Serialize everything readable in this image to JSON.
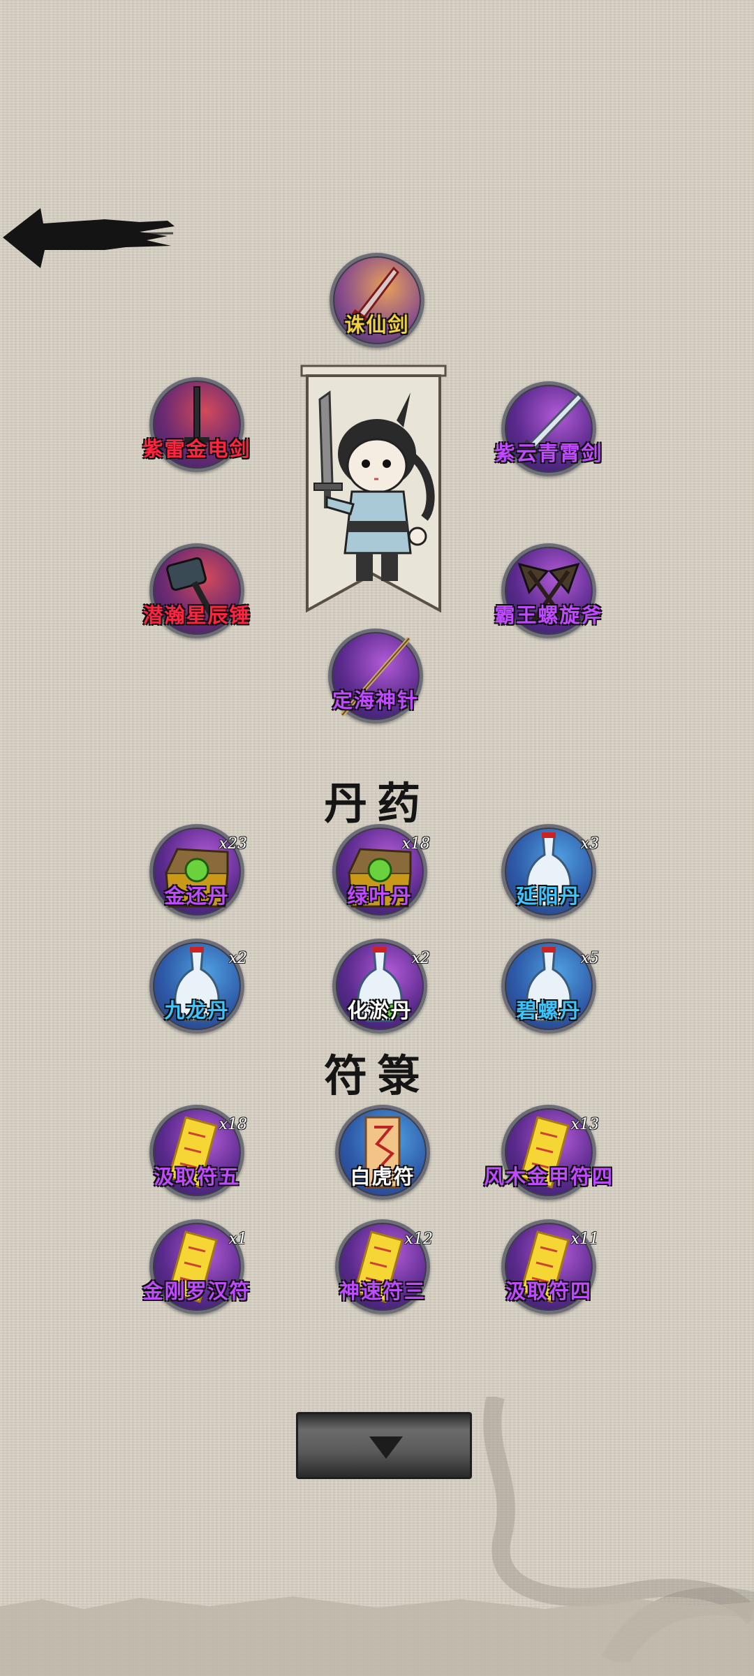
{
  "weapons": [
    {
      "name": "诛仙剑",
      "color": "gold",
      "disc": "orange",
      "icon": "crimson-sword-icon"
    },
    {
      "name": "紫雷金电剑",
      "color": "red",
      "disc": "red",
      "icon": "dark-sword-icon"
    },
    {
      "name": "紫云青霄剑",
      "color": "purple",
      "disc": "purple",
      "icon": "silver-sword-icon"
    },
    {
      "name": "潜瀚星辰锤",
      "color": "red",
      "disc": "red",
      "icon": "hammer-icon"
    },
    {
      "name": "霸王螺旋斧",
      "color": "purple",
      "disc": "purple",
      "icon": "double-axe-icon"
    },
    {
      "name": "定海神针",
      "color": "purple",
      "disc": "purple",
      "icon": "staff-icon"
    }
  ],
  "pills_title": "丹药",
  "pills": [
    {
      "name": "金还丹",
      "count": "x23",
      "color": "purple",
      "disc": "purple",
      "icon": "treasure-chest-icon"
    },
    {
      "name": "绿叶丹",
      "count": "x18",
      "color": "purple",
      "disc": "purple",
      "icon": "treasure-chest-icon"
    },
    {
      "name": "延阳丹",
      "count": "x3",
      "color": "blue",
      "disc": "blue",
      "icon": "porcelain-vase-icon"
    },
    {
      "name": "九龙丹",
      "count": "x2",
      "color": "blue",
      "disc": "blue",
      "icon": "porcelain-vase-icon"
    },
    {
      "name": "化淤丹",
      "count": "x2",
      "color": "white",
      "disc": "purple",
      "icon": "porcelain-vase-icon"
    },
    {
      "name": "碧螺丹",
      "count": "x5",
      "color": "blue",
      "disc": "blue",
      "icon": "porcelain-vase-icon"
    }
  ],
  "talismans_title": "符箓",
  "talismans": [
    {
      "name": "汲取符五",
      "count": "x18",
      "color": "purple",
      "disc": "purple",
      "icon": "golden-talisman-icon"
    },
    {
      "name": "白虎符",
      "count": "",
      "color": "white",
      "disc": "blue",
      "icon": "paper-talisman-icon"
    },
    {
      "name": "风木金甲符四",
      "count": "x13",
      "color": "purple",
      "disc": "purple",
      "icon": "golden-talisman-icon"
    },
    {
      "name": "金刚罗汉符",
      "count": "x1",
      "color": "purple",
      "disc": "purple",
      "icon": "golden-talisman-icon"
    },
    {
      "name": "神速符三",
      "count": "x12",
      "color": "purple",
      "disc": "purple",
      "icon": "golden-talisman-icon"
    },
    {
      "name": "汲取符四",
      "count": "x11",
      "color": "purple",
      "disc": "purple",
      "icon": "golden-talisman-icon"
    }
  ],
  "controls": {
    "back_icon": "ink-back-arrow-icon",
    "scroll_icon": "down-triangle-icon"
  }
}
